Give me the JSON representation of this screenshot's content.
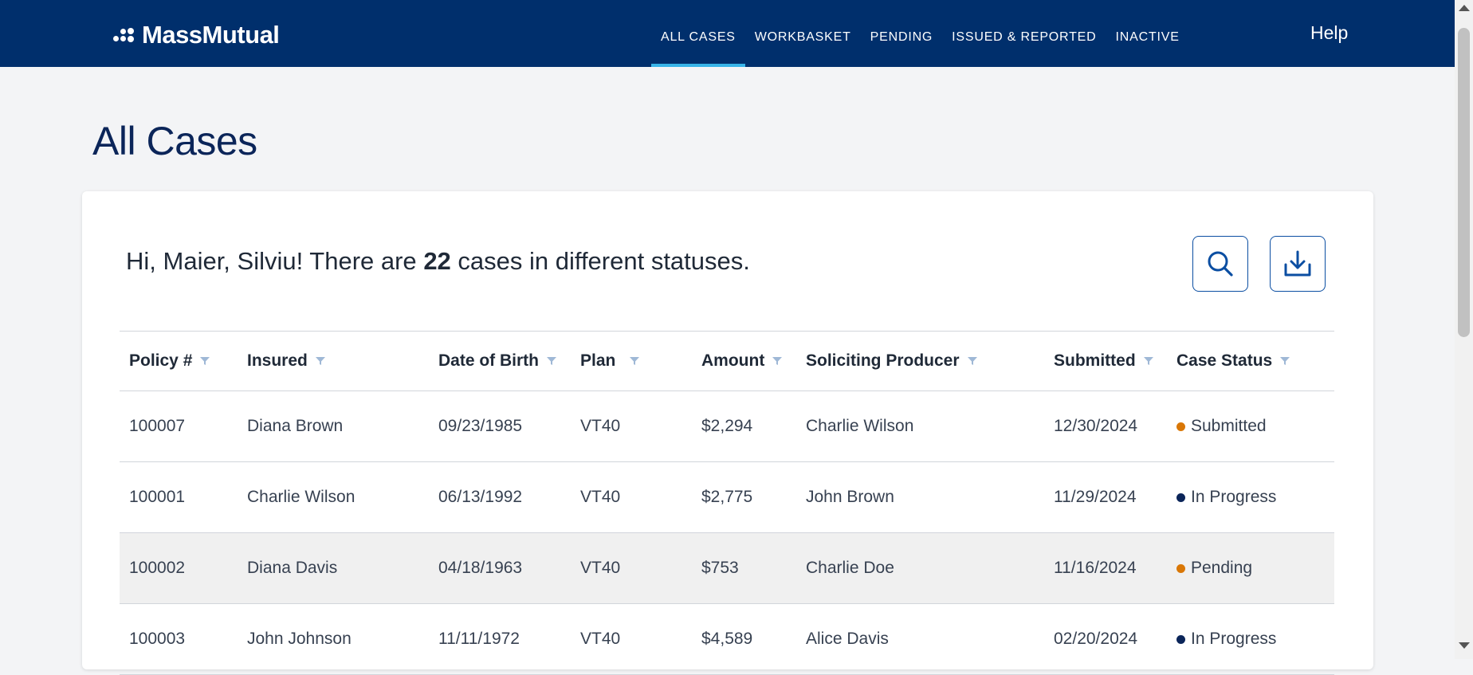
{
  "header": {
    "brand": "MassMutual",
    "nav": [
      {
        "label": "ALL CASES",
        "active": true
      },
      {
        "label": "WORKBASKET",
        "active": false
      },
      {
        "label": "PENDING",
        "active": false
      },
      {
        "label": "ISSUED & REPORTED",
        "active": false
      },
      {
        "label": "INACTIVE",
        "active": false
      }
    ],
    "help": "Help"
  },
  "page": {
    "title": "All Cases"
  },
  "summary": {
    "prefix": "Hi, Maier, Silviu! There are",
    "count": "22",
    "suffix": "cases in different statuses."
  },
  "actions": {
    "search_icon": "search-icon",
    "download_icon": "download-icon"
  },
  "table": {
    "headers": [
      "Policy #",
      "Insured",
      "Date of Birth",
      "Plan",
      "Amount",
      "Soliciting Producer",
      "Submitted",
      "Case Status"
    ],
    "rows": [
      {
        "policy": "100007",
        "insured": "Diana Brown",
        "dob": "09/23/1985",
        "plan": "VT40",
        "amount": "$2,294",
        "producer": "Charlie Wilson",
        "submitted": "12/30/2024",
        "status": "Submitted",
        "status_color": "#d97706"
      },
      {
        "policy": "100001",
        "insured": "Charlie Wilson",
        "dob": "06/13/1992",
        "plan": "VT40",
        "amount": "$2,775",
        "producer": "John Brown",
        "submitted": "11/29/2024",
        "status": "In Progress",
        "status_color": "#0b2559"
      },
      {
        "policy": "100002",
        "insured": "Diana Davis",
        "dob": "04/18/1963",
        "plan": "VT40",
        "amount": "$753",
        "producer": "Charlie Doe",
        "submitted": "11/16/2024",
        "status": "Pending",
        "status_color": "#d97706"
      },
      {
        "policy": "100003",
        "insured": "John Johnson",
        "dob": "11/11/1972",
        "plan": "VT40",
        "amount": "$4,589",
        "producer": "Alice Davis",
        "submitted": "02/20/2024",
        "status": "In Progress",
        "status_color": "#0b2559"
      }
    ]
  },
  "colors": {
    "header_bg": "#002f6c",
    "nav_active_underline": "#38b4e8",
    "accent": "#0b4ea2",
    "title": "#0b2559"
  }
}
